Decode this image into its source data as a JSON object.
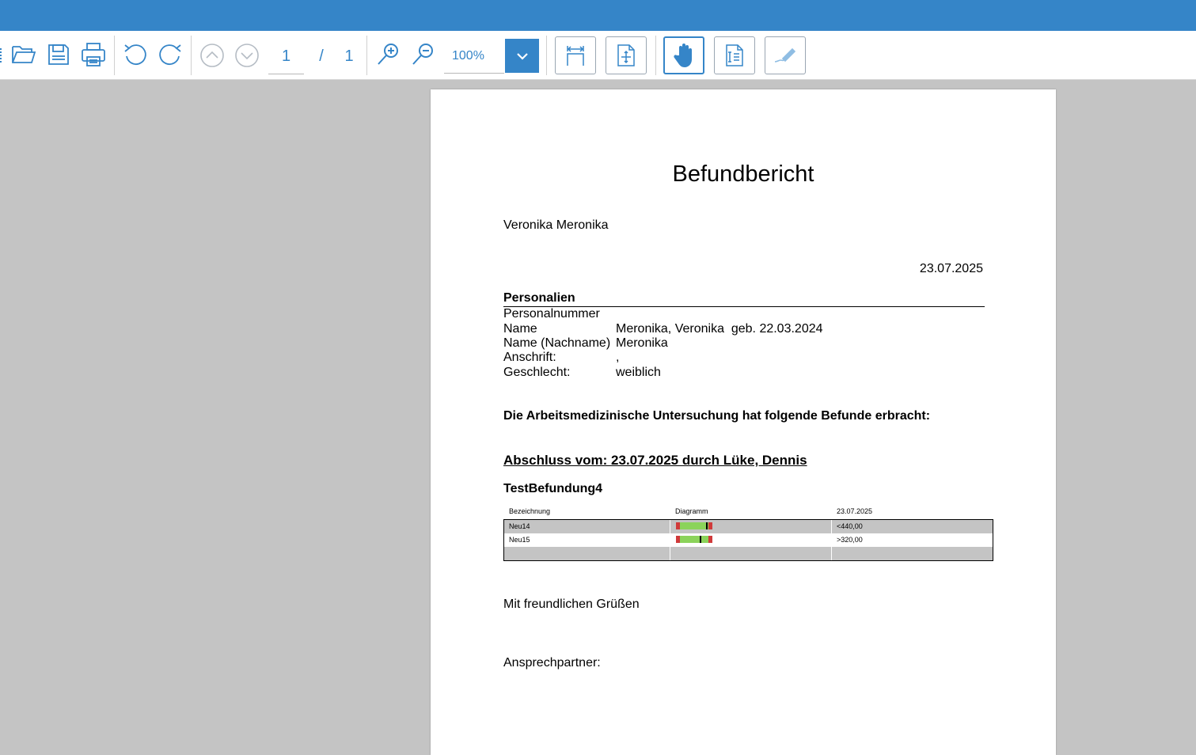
{
  "toolbar": {
    "page_current": "1",
    "page_separator": "/",
    "page_total": "1",
    "zoom_value": "100%",
    "accent_color": "#3585c8"
  },
  "icons": [
    "open-folder-icon",
    "save-icon",
    "print-icon",
    "undo-icon",
    "redo-icon",
    "prev-page-icon",
    "next-page-icon",
    "zoom-in-icon",
    "zoom-out-icon",
    "chevron-down-icon",
    "fit-width-icon",
    "fit-page-icon",
    "hand-tool-icon",
    "text-select-icon",
    "annotate-pen-icon"
  ],
  "document": {
    "title": "Befundbericht",
    "recipient": "Veronika Meronika",
    "date": "23.07.2025",
    "section_personalien": "Personalien",
    "personal_rows": [
      {
        "label": "Personalnummer",
        "value": ""
      },
      {
        "label": "Name",
        "value": "Meronika, Veronika  geb. 22.03.2024"
      },
      {
        "label": "Name (Nachname)",
        "value": "Meronika"
      },
      {
        "label": "Anschrift:",
        "value": ","
      },
      {
        "label": "Geschlecht:",
        "value": "weiblich"
      }
    ],
    "intro": "Die Arbeitsmedizinische Untersuchung hat folgende Befunde erbracht:",
    "abschluss": "Abschluss vom: 23.07.2025 durch Lüke, Dennis",
    "befund_title": "TestBefundung4",
    "table": {
      "headers": [
        "Bezeichnung",
        "Diagramm",
        "23.07.2025"
      ],
      "rows": [
        {
          "name": "Neu14",
          "value": "<440,00",
          "marker": 0.82
        },
        {
          "name": "Neu15",
          "value": ">320,00",
          "marker": 0.66
        }
      ]
    },
    "closing": "Mit freundlichen Grüßen",
    "contact": "Ansprechpartner:"
  }
}
